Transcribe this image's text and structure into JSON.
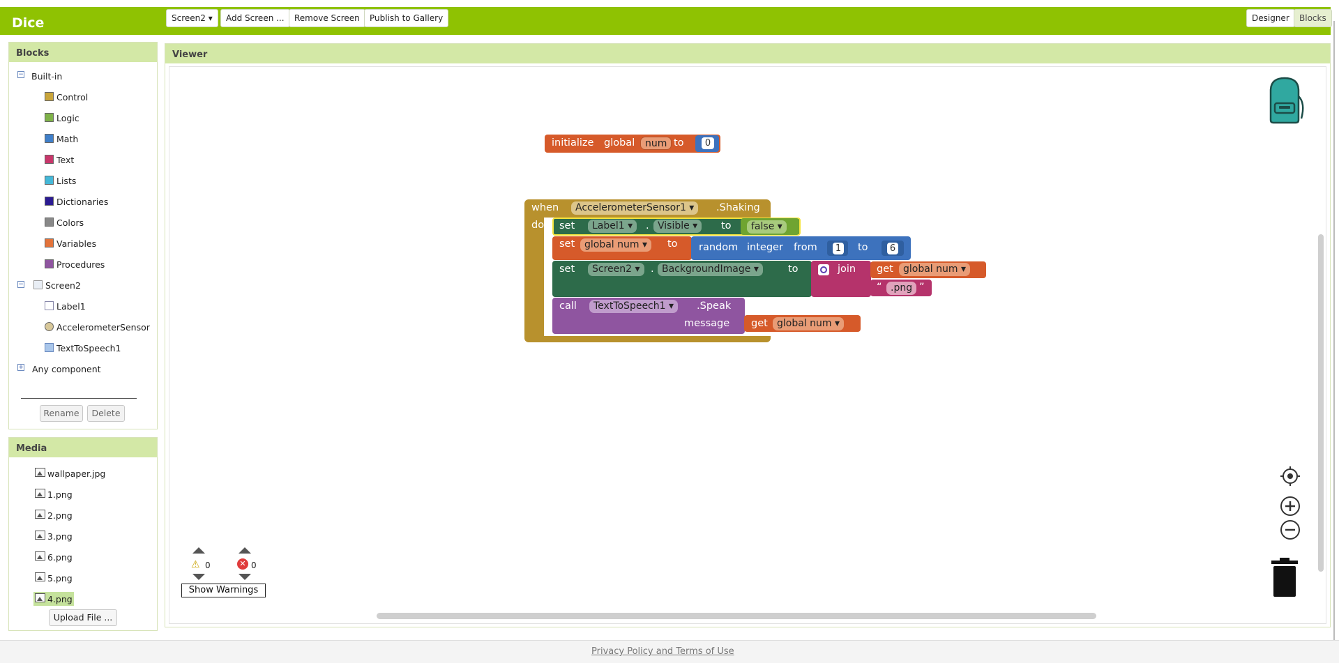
{
  "app": {
    "title": "Dice"
  },
  "toolbar": {
    "screen_select": "Screen2 ▾",
    "add_screen": "Add Screen ...",
    "remove_screen": "Remove Screen",
    "publish": "Publish to Gallery",
    "designer": "Designer",
    "blocks": "Blocks"
  },
  "blocks_panel": {
    "title": "Blocks",
    "builtin": "Built-in",
    "categories": [
      {
        "label": "Control",
        "color": "#c9a53b"
      },
      {
        "label": "Logic",
        "color": "#7fb249"
      },
      {
        "label": "Math",
        "color": "#3f7fc9"
      },
      {
        "label": "Text",
        "color": "#c9366b"
      },
      {
        "label": "Lists",
        "color": "#44b8d8"
      },
      {
        "label": "Dictionaries",
        "color": "#2b1b92"
      },
      {
        "label": "Colors",
        "color": "#888888"
      },
      {
        "label": "Variables",
        "color": "#e3733a"
      },
      {
        "label": "Procedures",
        "color": "#8f55a0"
      }
    ],
    "screen": "Screen2",
    "components": [
      "Label1",
      "AccelerometerSensor",
      "TextToSpeech1"
    ],
    "any_component": "Any component",
    "rename": "Rename",
    "delete": "Delete"
  },
  "media_panel": {
    "title": "Media",
    "files": [
      "wallpaper.jpg",
      "1.png",
      "2.png",
      "3.png",
      "6.png",
      "5.png",
      "4.png"
    ],
    "upload": "Upload File ..."
  },
  "viewer": {
    "title": "Viewer",
    "init_block": {
      "initialize": "initialize",
      "global": "global",
      "name": "num",
      "to": "to",
      "value": "0"
    },
    "event": {
      "when": "when",
      "component": "AccelerometerSensor1 ▾",
      "event": ".Shaking",
      "do": "do"
    },
    "stmt1": {
      "set": "set",
      "component": "Label1 ▾",
      "dot": ".",
      "prop": "Visible ▾",
      "to": "to",
      "value": "false ▾"
    },
    "stmt2": {
      "set": "set",
      "var": "global num ▾",
      "to": "to",
      "random": "random",
      "integer": "integer",
      "from": "from",
      "low": "1",
      "to2": "to",
      "high": "6"
    },
    "stmt3": {
      "set": "set",
      "component": "Screen2 ▾",
      "dot": ".",
      "prop": "BackgroundImage ▾",
      "to": "to",
      "join": "join",
      "get": "get",
      "var": "global num ▾",
      "text": ".png"
    },
    "stmt4": {
      "call": "call",
      "component": "TextToSpeech1 ▾",
      "method": ".Speak",
      "message": "message",
      "get": "get",
      "var": "global num ▾"
    },
    "warnings": {
      "warn_count": "0",
      "error_count": "0",
      "show": "Show Warnings"
    }
  },
  "footer": {
    "link": "Privacy Policy and Terms of Use"
  }
}
